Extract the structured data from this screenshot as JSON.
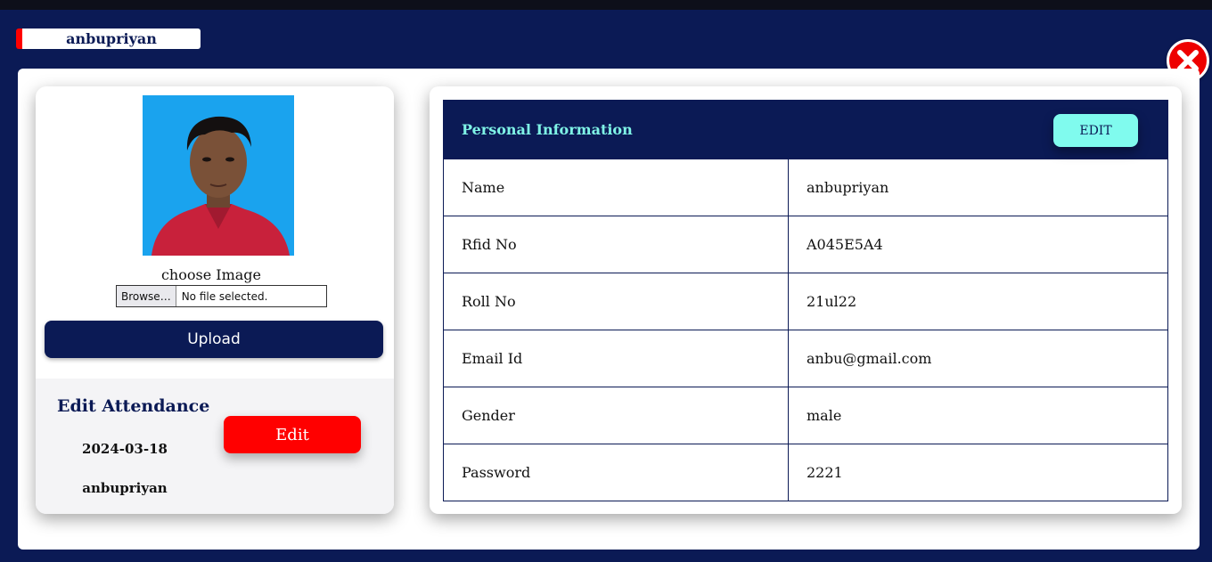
{
  "header": {
    "user_tag": "anbupriyan"
  },
  "profile": {
    "choose_label": "choose Image",
    "file_button_label": "Browse…",
    "file_status": "No file selected.",
    "upload_label": "Upload"
  },
  "attendance": {
    "title": "Edit Attendance",
    "date": "2024-03-18",
    "name": "anbupriyan",
    "edit_label": "Edit"
  },
  "personal": {
    "title": "Personal Information",
    "edit_label": "EDIT",
    "rows": [
      {
        "key": "Name",
        "value": "anbupriyan"
      },
      {
        "key": "Rfid No",
        "value": "A045E5A4"
      },
      {
        "key": "Roll No",
        "value": "21ul22"
      },
      {
        "key": "Email Id",
        "value": "anbu@gmail.com"
      },
      {
        "key": "Gender",
        "value": "male"
      },
      {
        "key": "Password",
        "value": "2221"
      }
    ]
  },
  "colors": {
    "navy": "#0b1a55",
    "accent_red": "#ff0000",
    "accent_cyan": "#80fbee"
  }
}
